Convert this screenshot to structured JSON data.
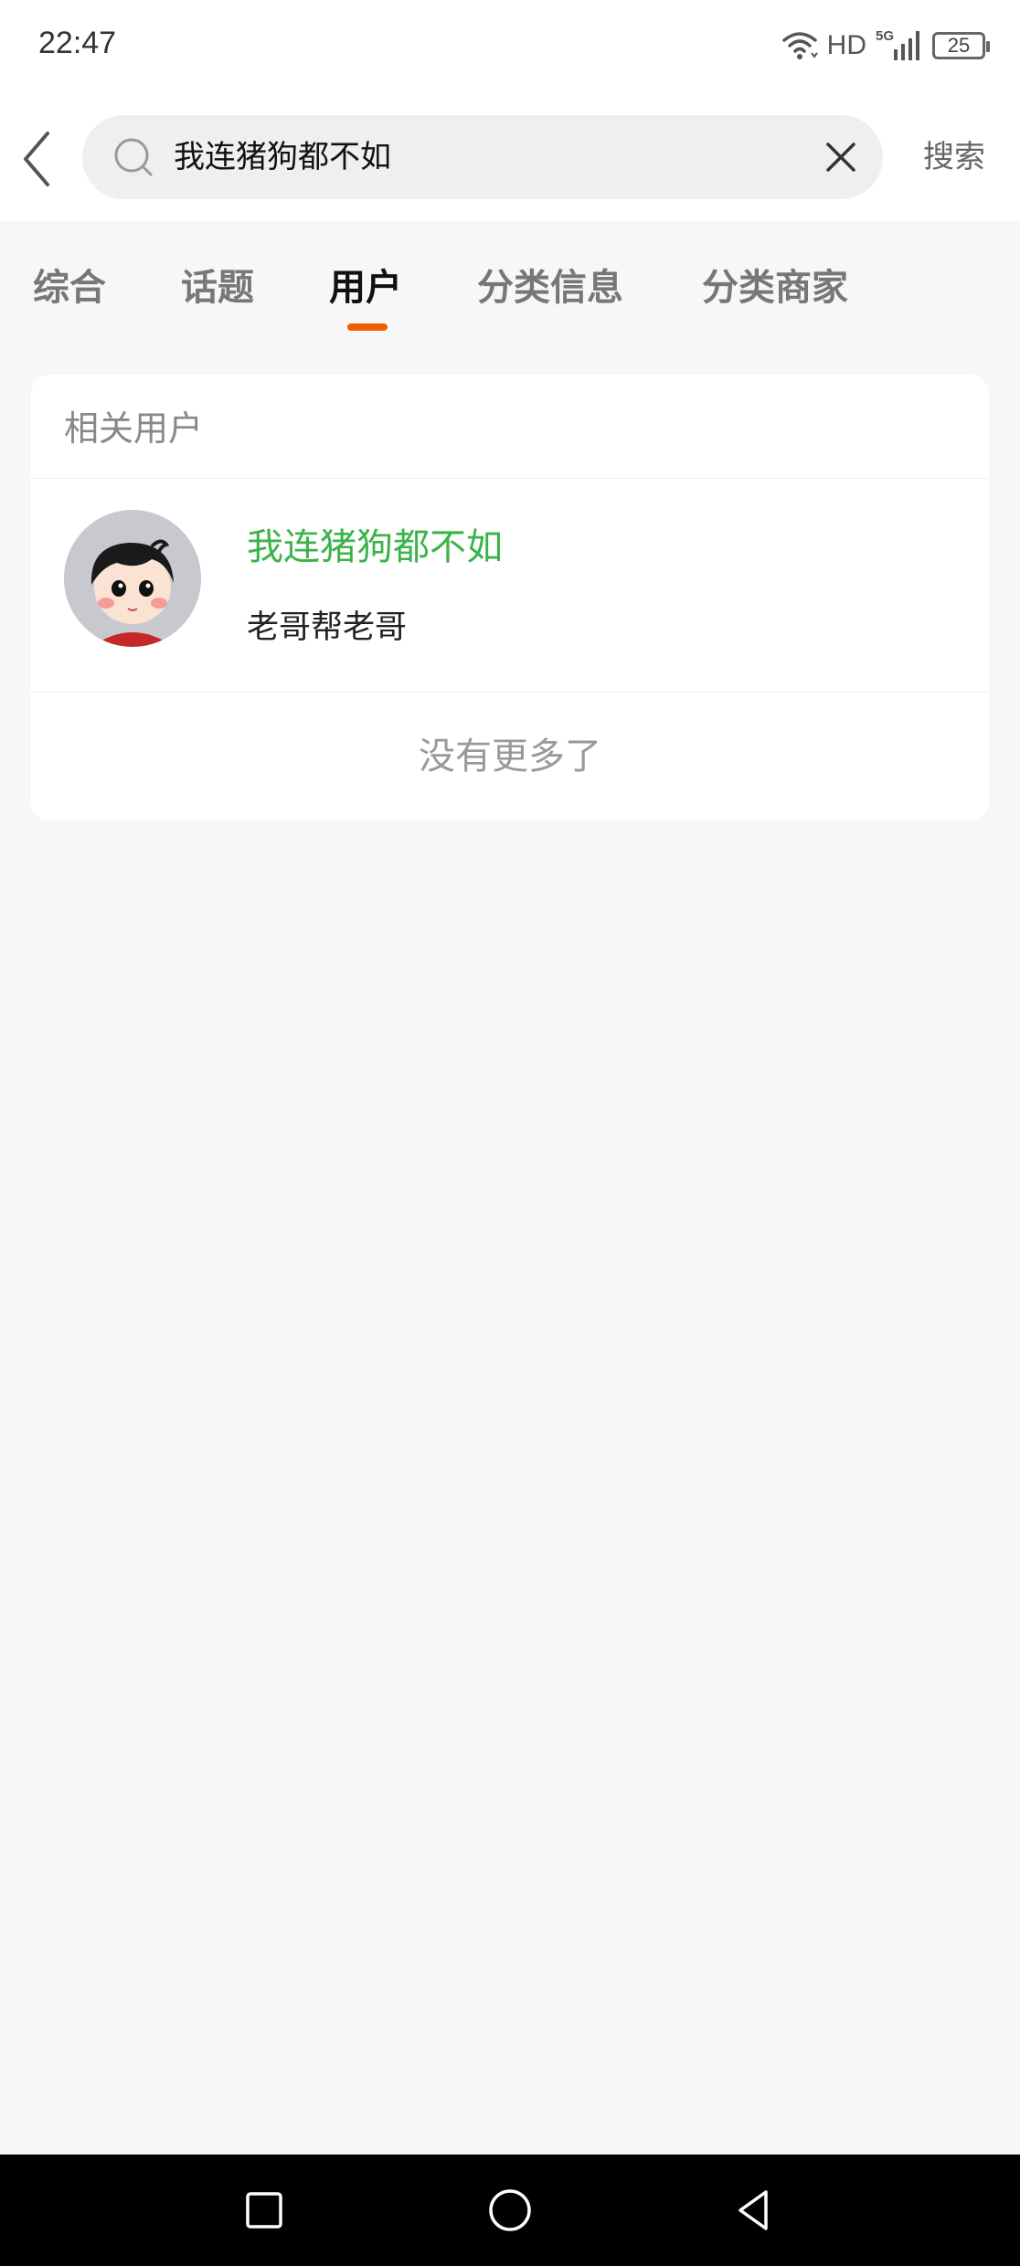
{
  "status_bar": {
    "time": "22:47",
    "network": "HD",
    "signal": "5G",
    "battery": "25"
  },
  "search": {
    "query": "我连猪狗都不如",
    "submit_label": "搜索"
  },
  "tabs": [
    {
      "label": "综合",
      "active": false
    },
    {
      "label": "话题",
      "active": false
    },
    {
      "label": "用户",
      "active": true
    },
    {
      "label": "分类信息",
      "active": false
    },
    {
      "label": "分类商家",
      "active": false
    }
  ],
  "accent_color": "#f25c05",
  "username_color": "#3cb34a",
  "results": {
    "section_title": "相关用户",
    "users": [
      {
        "name": "我连猪狗都不如",
        "description": "老哥帮老哥"
      }
    ],
    "end_text": "没有更多了"
  }
}
